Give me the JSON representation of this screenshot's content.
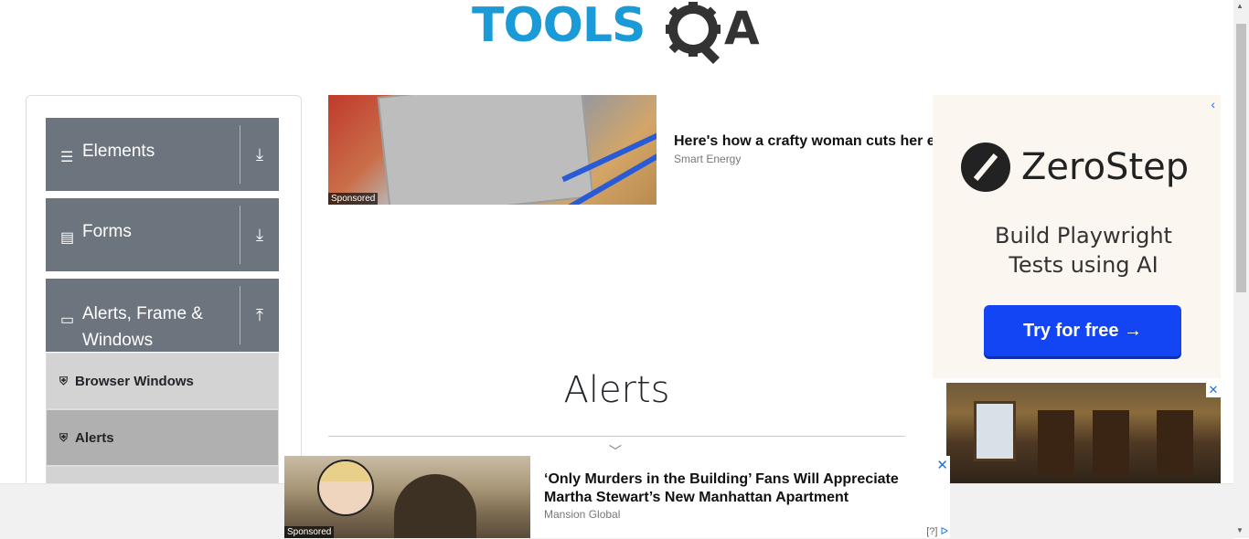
{
  "header": {
    "logo_left": "TOOLS",
    "logo_right": "A"
  },
  "sidebar": {
    "groups": [
      {
        "label": "Elements",
        "icon": "hamburger-icon",
        "toggle": "download-icon"
      },
      {
        "label": "Forms",
        "icon": "document-icon",
        "toggle": "download-icon"
      },
      {
        "label": "Alerts, Frame & Windows",
        "icon": "window-icon",
        "toggle": "upload-icon"
      }
    ],
    "items": [
      {
        "label": "Browser Windows",
        "active": false
      },
      {
        "label": "Alerts",
        "active": true
      }
    ]
  },
  "ads": {
    "top": {
      "sponsored": "Sponsored",
      "title": "Here's how a crafty woman cuts her e",
      "source": "Smart Energy"
    },
    "right": {
      "brand": "ZeroStep",
      "tagline": "Build Playwright Tests using AI",
      "cta": "Try for free →"
    },
    "bottom": {
      "sponsored": "Sponsored",
      "title": "‘Only Murders in the Building’ Fans Will Appreciate Martha Stewart’s New Manhattan Apartment",
      "source": "Mansion Global",
      "adchoice": "[?]"
    }
  },
  "main": {
    "title": "Alerts"
  },
  "colors": {
    "brand_blue": "#1b9ad8",
    "sidebar_group": "#6c757d",
    "cta_blue": "#1345f5"
  }
}
